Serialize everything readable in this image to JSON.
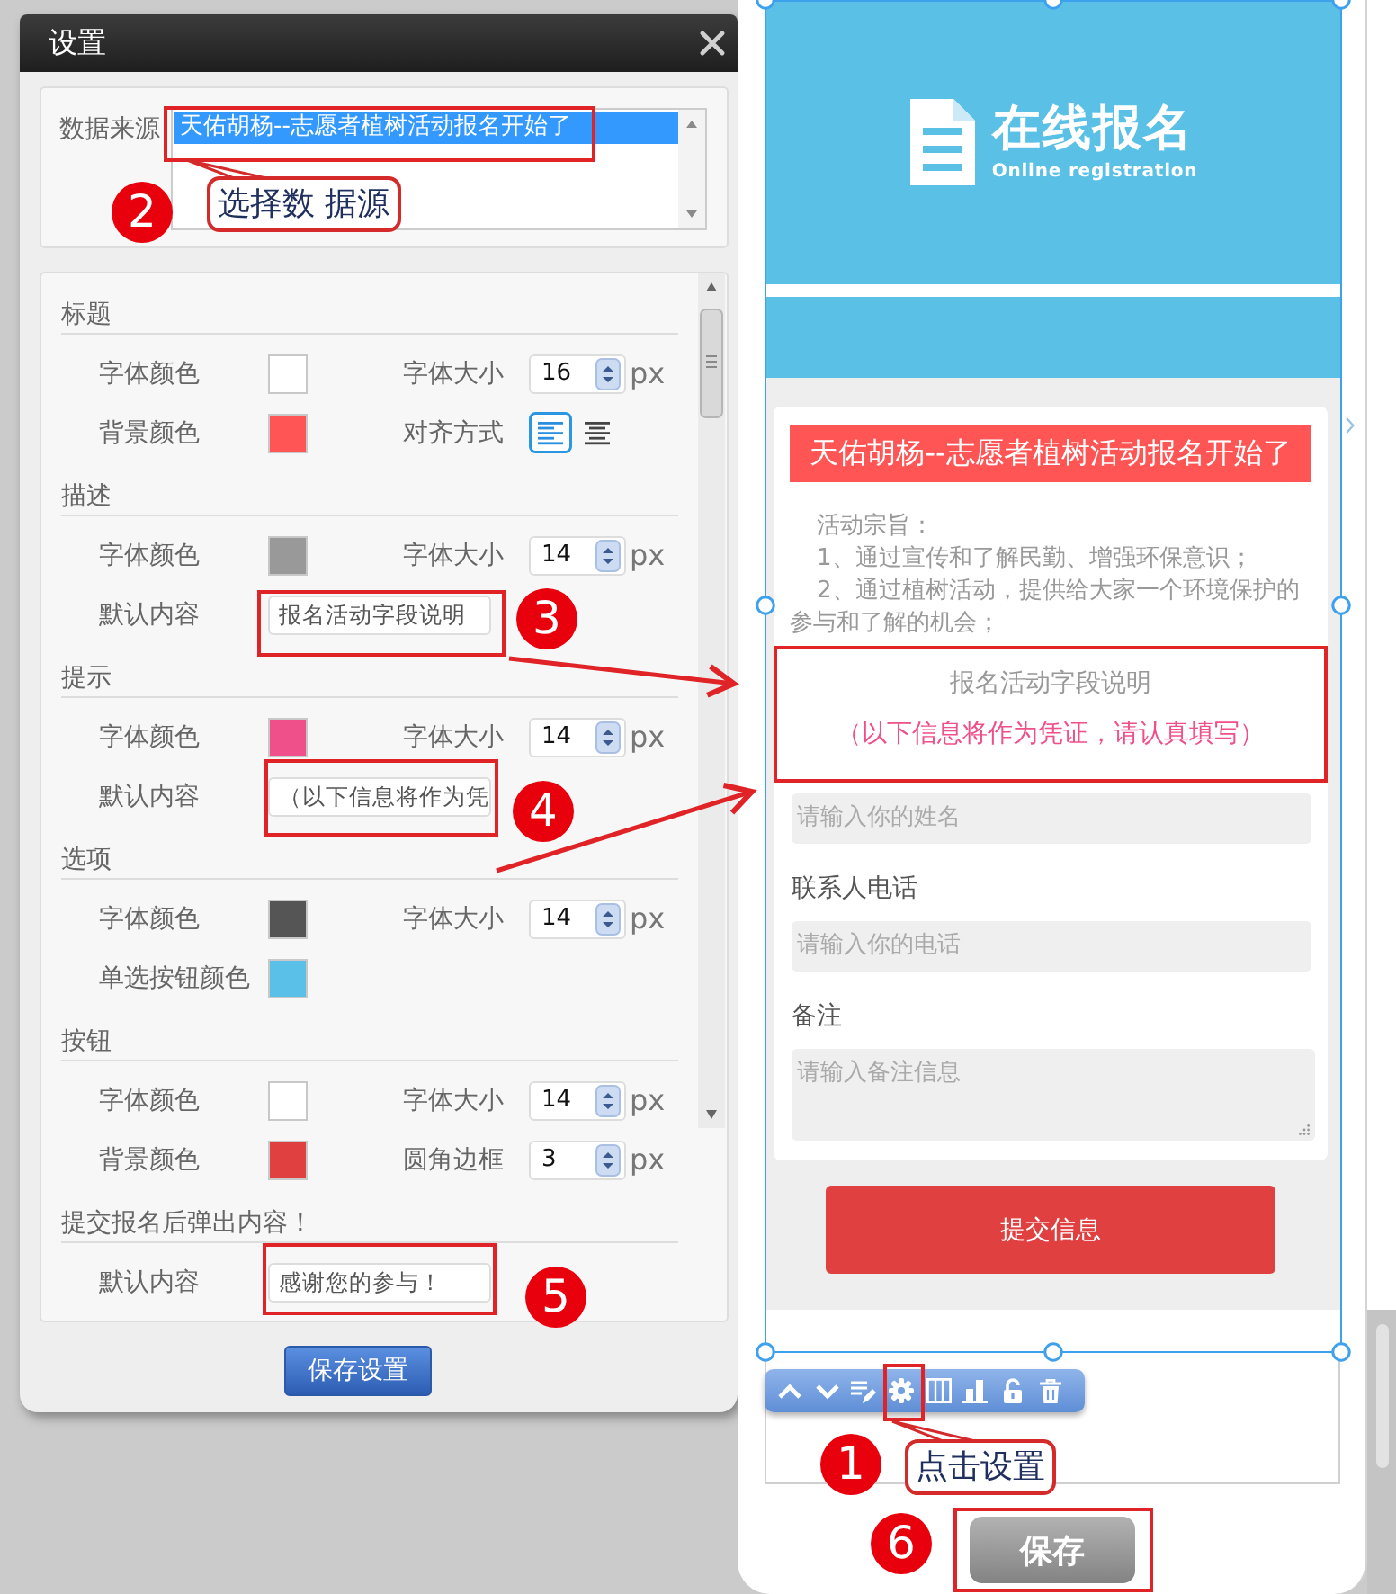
{
  "dialog": {
    "title": "设置",
    "data_source": {
      "label": "数据来源",
      "options": [
        {
          "label": "天佑胡杨--志愿者植树活动报名开始了",
          "selected": true
        }
      ]
    },
    "sections": [
      {
        "heading": "标题",
        "items": [
          {
            "kind": "color",
            "label": "字体颜色",
            "color": "#ffffff"
          },
          {
            "kind": "number",
            "label": "字体大小",
            "value": "16",
            "unit": "px"
          },
          {
            "kind": "color",
            "label": "背景颜色",
            "color": "#ff5555"
          },
          {
            "kind": "align",
            "label": "对齐方式",
            "options": [
              {
                "selected": true
              },
              {
                "selected": false
              }
            ]
          }
        ]
      },
      {
        "heading": "描述",
        "items": [
          {
            "kind": "color",
            "label": "字体颜色",
            "color": "#999999"
          },
          {
            "kind": "number",
            "label": "字体大小",
            "value": "14",
            "unit": "px"
          },
          {
            "kind": "text",
            "label": "默认内容",
            "value": "报名活动字段说明"
          }
        ]
      },
      {
        "heading": "提示",
        "items": [
          {
            "kind": "color",
            "label": "字体颜色",
            "color": "#f0508a"
          },
          {
            "kind": "number",
            "label": "字体大小",
            "value": "14",
            "unit": "px"
          },
          {
            "kind": "text",
            "label": "默认内容",
            "value": "（以下信息将作为凭"
          }
        ]
      },
      {
        "heading": "选项",
        "items": [
          {
            "kind": "color",
            "label": "字体颜色",
            "color": "#555555"
          },
          {
            "kind": "number",
            "label": "字体大小",
            "value": "14",
            "unit": "px"
          },
          {
            "kind": "color",
            "label": "单选按钮颜色",
            "color": "#5bc0e8"
          }
        ]
      },
      {
        "heading": "按钮",
        "items": [
          {
            "kind": "color",
            "label": "字体颜色",
            "color": "#ffffff"
          },
          {
            "kind": "number",
            "label": "字体大小",
            "value": "14",
            "unit": "px"
          },
          {
            "kind": "color",
            "label": "背景颜色",
            "color": "#e04040"
          },
          {
            "kind": "number",
            "label": "圆角边框",
            "value": "3",
            "unit": "px"
          }
        ]
      },
      {
        "heading": "提交报名后弹出内容！",
        "items": [
          {
            "kind": "text",
            "label": "默认内容",
            "value": "感谢您的参与！"
          }
        ]
      }
    ],
    "save_button": "保存设置"
  },
  "preview": {
    "banner": {
      "title": "在线报名",
      "subtitle": "Online registration"
    },
    "form_title": "天佑胡杨--志愿者植树活动报名开始了",
    "description": [
      "活动宗旨：",
      "1、通过宣传和了解民勤、增强环保意识；",
      "2、通过植树活动，提供给大家一个环境保护的参与和了解的机会；"
    ],
    "intro": "报名活动字段说明",
    "hint": "（以下信息将作为凭证，请认真填写）",
    "fields": [
      {
        "kind": "input",
        "placeholder": "请输入你的姓名"
      },
      {
        "kind": "input",
        "label": "联系人电话",
        "placeholder": "请输入你的电话"
      },
      {
        "kind": "textarea",
        "label": "备注",
        "placeholder": "请输入备注信息"
      }
    ],
    "submit_button": "提交信息",
    "save_button": "保存"
  },
  "annotations": [
    {
      "number": "1",
      "callout": "点击设置"
    },
    {
      "number": "2",
      "callout": "选择数 据源"
    },
    {
      "number": "3"
    },
    {
      "number": "4"
    },
    {
      "number": "5"
    },
    {
      "number": "6"
    }
  ]
}
